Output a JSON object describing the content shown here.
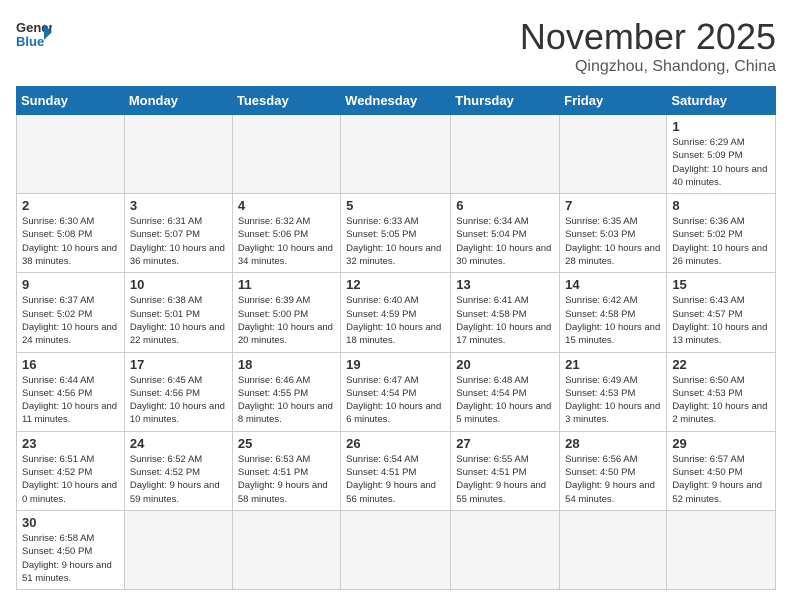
{
  "header": {
    "logo_line1": "General",
    "logo_line2": "Blue",
    "month": "November 2025",
    "location": "Qingzhou, Shandong, China"
  },
  "days_of_week": [
    "Sunday",
    "Monday",
    "Tuesday",
    "Wednesday",
    "Thursday",
    "Friday",
    "Saturday"
  ],
  "weeks": [
    [
      {
        "day": "",
        "info": ""
      },
      {
        "day": "",
        "info": ""
      },
      {
        "day": "",
        "info": ""
      },
      {
        "day": "",
        "info": ""
      },
      {
        "day": "",
        "info": ""
      },
      {
        "day": "",
        "info": ""
      },
      {
        "day": "1",
        "info": "Sunrise: 6:29 AM\nSunset: 5:09 PM\nDaylight: 10 hours and 40 minutes."
      }
    ],
    [
      {
        "day": "2",
        "info": "Sunrise: 6:30 AM\nSunset: 5:08 PM\nDaylight: 10 hours and 38 minutes."
      },
      {
        "day": "3",
        "info": "Sunrise: 6:31 AM\nSunset: 5:07 PM\nDaylight: 10 hours and 36 minutes."
      },
      {
        "day": "4",
        "info": "Sunrise: 6:32 AM\nSunset: 5:06 PM\nDaylight: 10 hours and 34 minutes."
      },
      {
        "day": "5",
        "info": "Sunrise: 6:33 AM\nSunset: 5:05 PM\nDaylight: 10 hours and 32 minutes."
      },
      {
        "day": "6",
        "info": "Sunrise: 6:34 AM\nSunset: 5:04 PM\nDaylight: 10 hours and 30 minutes."
      },
      {
        "day": "7",
        "info": "Sunrise: 6:35 AM\nSunset: 5:03 PM\nDaylight: 10 hours and 28 minutes."
      },
      {
        "day": "8",
        "info": "Sunrise: 6:36 AM\nSunset: 5:02 PM\nDaylight: 10 hours and 26 minutes."
      }
    ],
    [
      {
        "day": "9",
        "info": "Sunrise: 6:37 AM\nSunset: 5:02 PM\nDaylight: 10 hours and 24 minutes."
      },
      {
        "day": "10",
        "info": "Sunrise: 6:38 AM\nSunset: 5:01 PM\nDaylight: 10 hours and 22 minutes."
      },
      {
        "day": "11",
        "info": "Sunrise: 6:39 AM\nSunset: 5:00 PM\nDaylight: 10 hours and 20 minutes."
      },
      {
        "day": "12",
        "info": "Sunrise: 6:40 AM\nSunset: 4:59 PM\nDaylight: 10 hours and 18 minutes."
      },
      {
        "day": "13",
        "info": "Sunrise: 6:41 AM\nSunset: 4:58 PM\nDaylight: 10 hours and 17 minutes."
      },
      {
        "day": "14",
        "info": "Sunrise: 6:42 AM\nSunset: 4:58 PM\nDaylight: 10 hours and 15 minutes."
      },
      {
        "day": "15",
        "info": "Sunrise: 6:43 AM\nSunset: 4:57 PM\nDaylight: 10 hours and 13 minutes."
      }
    ],
    [
      {
        "day": "16",
        "info": "Sunrise: 6:44 AM\nSunset: 4:56 PM\nDaylight: 10 hours and 11 minutes."
      },
      {
        "day": "17",
        "info": "Sunrise: 6:45 AM\nSunset: 4:56 PM\nDaylight: 10 hours and 10 minutes."
      },
      {
        "day": "18",
        "info": "Sunrise: 6:46 AM\nSunset: 4:55 PM\nDaylight: 10 hours and 8 minutes."
      },
      {
        "day": "19",
        "info": "Sunrise: 6:47 AM\nSunset: 4:54 PM\nDaylight: 10 hours and 6 minutes."
      },
      {
        "day": "20",
        "info": "Sunrise: 6:48 AM\nSunset: 4:54 PM\nDaylight: 10 hours and 5 minutes."
      },
      {
        "day": "21",
        "info": "Sunrise: 6:49 AM\nSunset: 4:53 PM\nDaylight: 10 hours and 3 minutes."
      },
      {
        "day": "22",
        "info": "Sunrise: 6:50 AM\nSunset: 4:53 PM\nDaylight: 10 hours and 2 minutes."
      }
    ],
    [
      {
        "day": "23",
        "info": "Sunrise: 6:51 AM\nSunset: 4:52 PM\nDaylight: 10 hours and 0 minutes."
      },
      {
        "day": "24",
        "info": "Sunrise: 6:52 AM\nSunset: 4:52 PM\nDaylight: 9 hours and 59 minutes."
      },
      {
        "day": "25",
        "info": "Sunrise: 6:53 AM\nSunset: 4:51 PM\nDaylight: 9 hours and 58 minutes."
      },
      {
        "day": "26",
        "info": "Sunrise: 6:54 AM\nSunset: 4:51 PM\nDaylight: 9 hours and 56 minutes."
      },
      {
        "day": "27",
        "info": "Sunrise: 6:55 AM\nSunset: 4:51 PM\nDaylight: 9 hours and 55 minutes."
      },
      {
        "day": "28",
        "info": "Sunrise: 6:56 AM\nSunset: 4:50 PM\nDaylight: 9 hours and 54 minutes."
      },
      {
        "day": "29",
        "info": "Sunrise: 6:57 AM\nSunset: 4:50 PM\nDaylight: 9 hours and 52 minutes."
      }
    ],
    [
      {
        "day": "30",
        "info": "Sunrise: 6:58 AM\nSunset: 4:50 PM\nDaylight: 9 hours and 51 minutes."
      },
      {
        "day": "",
        "info": ""
      },
      {
        "day": "",
        "info": ""
      },
      {
        "day": "",
        "info": ""
      },
      {
        "day": "",
        "info": ""
      },
      {
        "day": "",
        "info": ""
      },
      {
        "day": "",
        "info": ""
      }
    ]
  ]
}
